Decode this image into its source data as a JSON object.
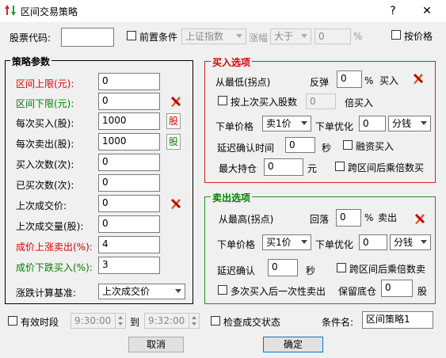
{
  "window": {
    "title": "区间交易策略",
    "help": "?",
    "close": "✕"
  },
  "top": {
    "stock_code_label": "股票代码:",
    "stock_code_value": "",
    "pre_condition_label": "前置条件",
    "index_select": "上证指数",
    "change_label": "涨幅",
    "compare_select": "大于",
    "compare_value": "0",
    "percent": "%",
    "by_price_label": "按价格"
  },
  "strategy": {
    "title": "策略参数",
    "fields": [
      {
        "label": "区间上限(元):",
        "value": "0",
        "color": "red"
      },
      {
        "label": "区间下限(元):",
        "value": "0",
        "color": "green"
      },
      {
        "label": "每次买入(股):",
        "value": "1000",
        "color": "black",
        "tag": "股"
      },
      {
        "label": "每次卖出(股):",
        "value": "1000",
        "color": "black",
        "tag": "股"
      },
      {
        "label": "买入次数(次):",
        "value": "0",
        "color": "black"
      },
      {
        "label": "已买次数(次):",
        "value": "0",
        "color": "black"
      },
      {
        "label": "上次成交价:",
        "value": "0",
        "color": "black"
      },
      {
        "label": "上次成交量(股):",
        "value": "0",
        "color": "black"
      },
      {
        "label": "成价上涨卖出(%):",
        "value": "4",
        "color": "red"
      },
      {
        "label": "成价下跌买入(%):",
        "value": "3",
        "color": "green"
      }
    ],
    "basis_label": "涨跌计算基准:",
    "basis_select": "上次成交价"
  },
  "buy": {
    "title": "买入选项",
    "from_low_label": "从最低(拐点)",
    "rebound_label": "反弹",
    "rebound_value": "0",
    "percent": "%",
    "buy_label": "买入",
    "by_last_qty_label": "按上次买入股数",
    "times_value": "0",
    "times_label": "倍买入",
    "order_price_label": "下单价格",
    "order_price_select": "卖1价",
    "optimize_label": "下单优化",
    "optimize_value": "0",
    "unit_select": "分钱",
    "delay_label": "延迟确认时间",
    "delay_value": "0",
    "sec_label": "秒",
    "margin_label": "融资买入",
    "max_position_label": "最大持仓",
    "max_position_value": "0",
    "yuan_label": "元",
    "cross_label": "跨区间后乘倍数买"
  },
  "sell": {
    "title": "卖出选项",
    "from_high_label": "从最高(拐点)",
    "pullback_label": "回落",
    "pullback_value": "0",
    "percent": "%",
    "sell_label": "卖出",
    "order_price_label": "下单价格",
    "order_price_select": "买1价",
    "optimize_label": "下单优化",
    "optimize_value": "0",
    "unit_select": "分钱",
    "delay_label": "延迟确认",
    "delay_value": "0",
    "sec_label": "秒",
    "cross_label": "跨区间后乘倍数卖",
    "multi_label": "多次买入后一次性卖出",
    "keep_label": "保留底仓",
    "keep_value": "0",
    "share_label": "股"
  },
  "bottom": {
    "valid_period_label": "有效时段",
    "start_time": "9:30:00",
    "to_label": "到",
    "end_time": "9:32:00",
    "check_status_label": "检查成交状态",
    "condition_name_label": "条件名:",
    "condition_name_value": "区间策略1",
    "cancel": "取消",
    "confirm": "确定"
  }
}
